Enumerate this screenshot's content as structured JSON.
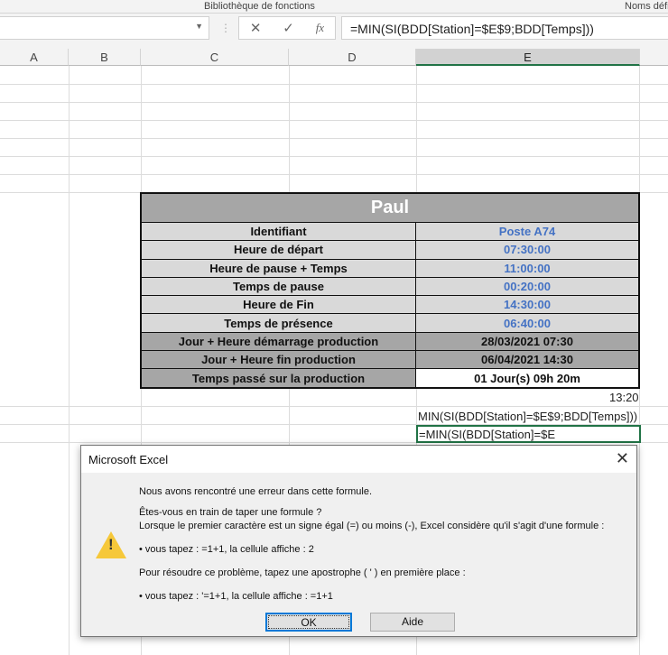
{
  "ribbon": {
    "group1": "Bibliothèque de fonctions",
    "group2": "Noms défi"
  },
  "formula_bar": {
    "cancel_icon": "✕",
    "enter_icon": "✓",
    "fx_icon": "fx",
    "formula": "=MIN(SI(BDD[Station]=$E$9;BDD[Temps]))"
  },
  "columns": [
    "A",
    "B",
    "C",
    "D",
    "E"
  ],
  "table": {
    "title": "Paul",
    "rows": [
      {
        "label": "Identifiant",
        "value": "Poste A74"
      },
      {
        "label": "Heure de départ",
        "value": "07:30:00"
      },
      {
        "label": "Heure de pause + Temps",
        "value": "11:00:00"
      },
      {
        "label": "Temps de pause",
        "value": "00:20:00"
      },
      {
        "label": "Heure de Fin",
        "value": "14:30:00"
      },
      {
        "label": "Temps de présence",
        "value": "06:40:00"
      },
      {
        "label": "Jour + Heure démarrage production",
        "value": "28/03/2021 07:30"
      },
      {
        "label": "Jour + Heure fin production",
        "value": "06/04/2021 14:30"
      },
      {
        "label": "Temps passé sur la production",
        "value": "01 Jour(s) 09h 20m"
      }
    ]
  },
  "cells": {
    "time": "13:20",
    "formula_text": "MIN(SI(BDD[Station]=$E$9;BDD[Temps]))",
    "editing": "=MIN(SI(BDD[Station]=$E"
  },
  "dialog": {
    "title": "Microsoft Excel",
    "close": "✕",
    "line1": "Nous avons rencontré une erreur dans cette formule.",
    "line2": "Êtes-vous en train de taper une formule ?",
    "line3": "Lorsque le premier caractère est un signe égal (=) ou moins (-), Excel considère qu'il s'agit d'une formule :",
    "line4": "• vous tapez :   =1+1, la cellule affiche :   2",
    "line5": "Pour résoudre ce problème, tapez une apostrophe ( ' ) en première place :",
    "line6": "• vous tapez :   '=1+1, la cellule affiche :   =1+1",
    "warning_icon": "!",
    "ok": "OK",
    "help": "Aide"
  }
}
